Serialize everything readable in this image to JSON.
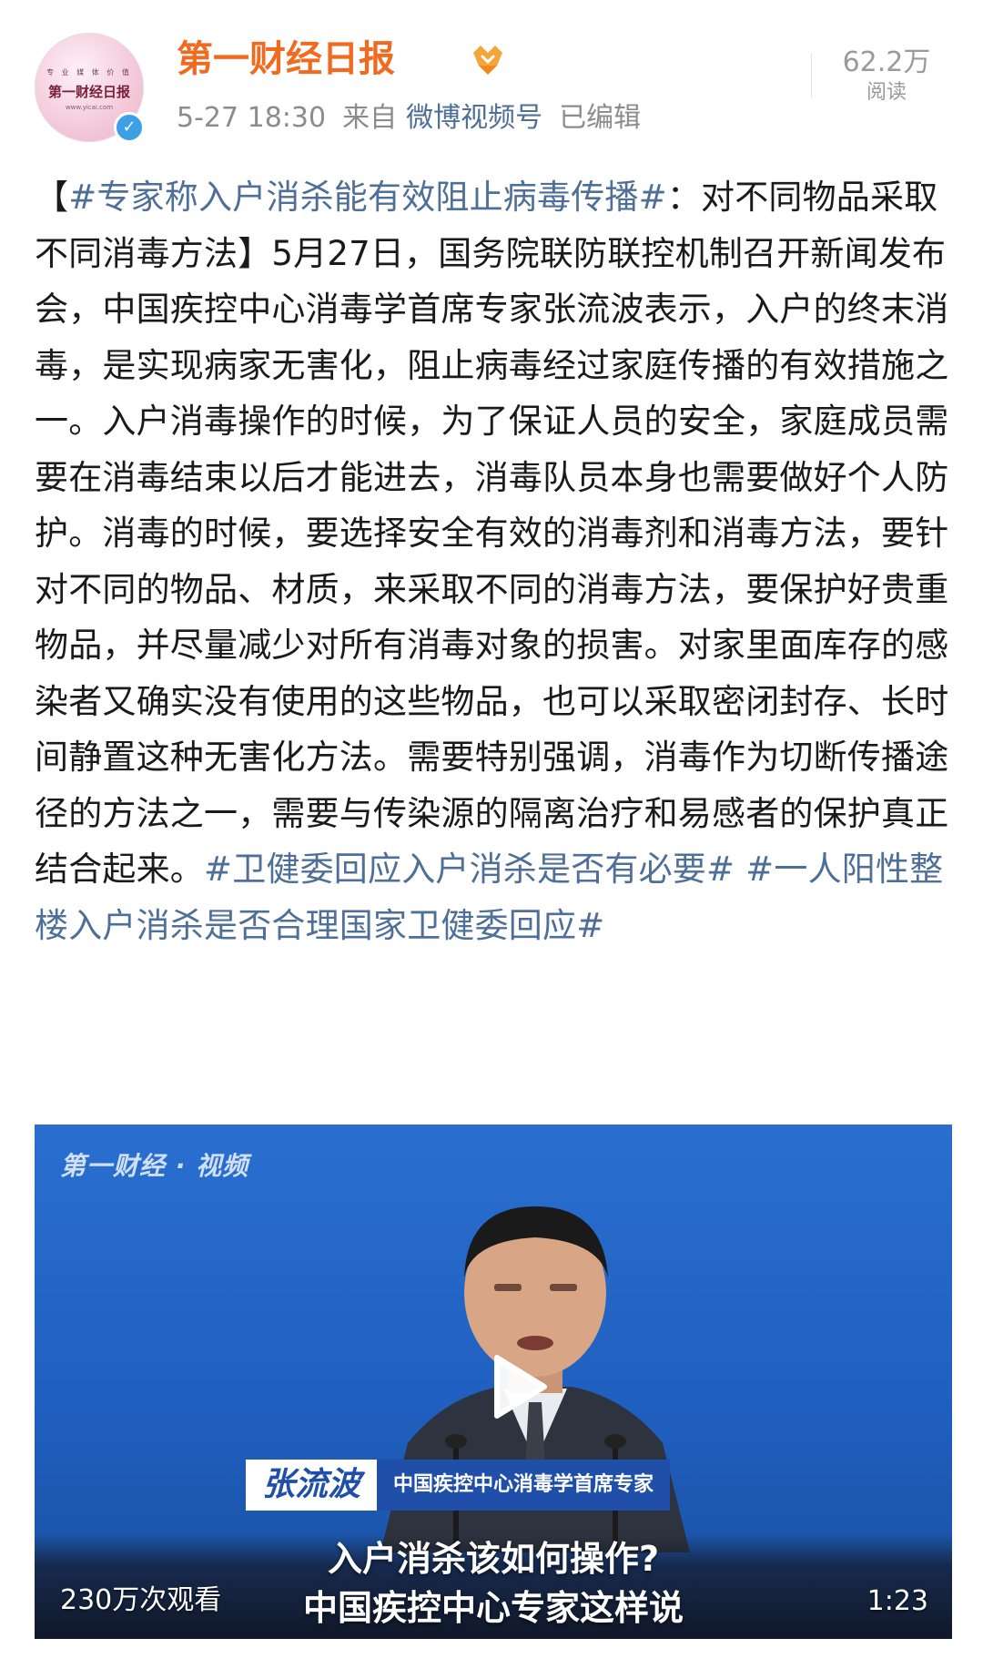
{
  "header": {
    "avatar": {
      "small_text": "专 业 媒 体 价 值",
      "title": "第一财经日报",
      "url": "www.yicai.com",
      "verified_icon": "verified-check-icon"
    },
    "account_name": "第一财经日报",
    "badge_icon": "gold-member-badge-icon",
    "time": "5-27 18:30",
    "source_prefix": "来自",
    "source": "微博视频号",
    "edited": "已编辑",
    "reads_count": "62.2万",
    "reads_label": "阅读"
  },
  "post": {
    "open_bracket": "【",
    "topic_main": "#专家称入户消杀能有效阻止病毒传播#",
    "headline_rest": "：对不同物品采取不同消毒方法】",
    "body": "5月27日，国务院联防联控机制召开新闻发布会，中国疾控中心消毒学首席专家张流波表示，入户的终末消毒，是实现病家无害化，阻止病毒经过家庭传播的有效措施之一。入户消毒操作的时候，为了保证人员的安全，家庭成员需要在消毒结束以后才能进去，消毒队员本身也需要做好个人防护。消毒的时候，要选择安全有效的消毒剂和消毒方法，要针对不同的物品、材质，来采取不同的消毒方法，要保护好贵重物品，并尽量减少对所有消毒对象的损害。对家里面库存的感染者又确实没有使用的这些物品，也可以采取密闭封存、长时间静置这种无害化方法。需要特别强调，消毒作为切断传播途径的方法之一，需要与传染源的隔离治疗和易感者的保护真正结合起来。",
    "topic_2": "#卫健委回应入户消杀是否有必要#",
    "topic_3": "#一人阳性整楼入户消杀是否合理国家卫健委回应#"
  },
  "video": {
    "watermark": "第一财经 · 视频",
    "speaker_name": "张流波",
    "speaker_title": "中国疾控中心消毒学首席专家",
    "subtitle_line1": "入户消杀该如何操作?",
    "subtitle_line2": "中国疾控中心专家这样说",
    "view_count": "230万次观看",
    "duration": "1:23",
    "play_icon": "play-icon",
    "colors": {
      "background": "#2a6fd0",
      "name_plate": "#1f4fa8"
    }
  },
  "colors": {
    "account_name": "#f06b1f",
    "link": "#4e6f97",
    "meta": "#8c8c8c"
  }
}
